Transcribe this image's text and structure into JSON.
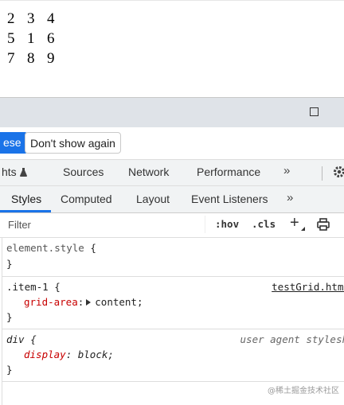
{
  "page": {
    "grid_rows": [
      [
        "2",
        "3",
        "4"
      ],
      [
        "5",
        "1",
        "6"
      ],
      [
        "7",
        "8",
        "9"
      ]
    ]
  },
  "infobar": {
    "primary_label": "ese",
    "secondary_label": "Don't show again"
  },
  "main_tabs": {
    "partial_label": "hts",
    "items": [
      "Sources",
      "Network",
      "Performance"
    ],
    "more_symbol": "»"
  },
  "sub_tabs": {
    "items": [
      "Styles",
      "Computed",
      "Layout",
      "Event Listeners"
    ],
    "active": "Styles",
    "more_symbol": "»"
  },
  "filter": {
    "placeholder": "Filter",
    "hov": ":hov",
    "cls": ".cls",
    "plus": "+"
  },
  "rules": {
    "element_style": {
      "selector": "element.style",
      "open": "{",
      "close": "}"
    },
    "item1": {
      "selector": ".item-1",
      "open": "{",
      "source": "testGrid.html",
      "property": "grid-area",
      "value": "content;",
      "close": "}"
    },
    "div": {
      "selector": "div",
      "open": "{",
      "source": "user agent stylesh",
      "property": "display",
      "value": "block;",
      "close": "}"
    }
  },
  "watermark": "@稀土掘金技术社区",
  "colors": {
    "accent": "#1a73e8",
    "property": "#c80000",
    "titlebar": "#dfe3e8",
    "toolbar": "#f1f3f4"
  }
}
